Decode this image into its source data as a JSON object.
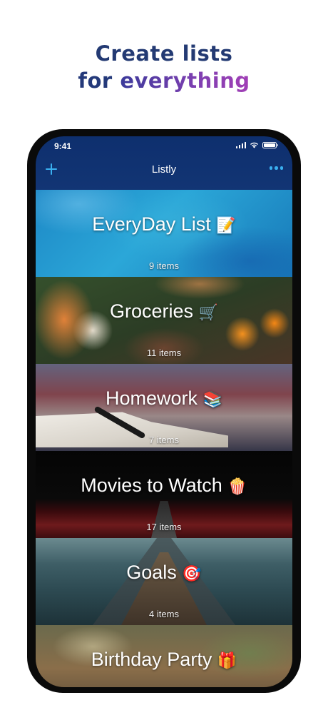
{
  "headline": {
    "line1": "Create lists",
    "line2_prefix": "for ",
    "line2_accent": "everything"
  },
  "status": {
    "time": "9:41"
  },
  "nav": {
    "title": "Listly",
    "add_icon": "plus-icon",
    "more_icon": "ellipsis-icon"
  },
  "lists": [
    {
      "name": "EveryDay List",
      "emoji": "📝",
      "count": "9 items"
    },
    {
      "name": "Groceries",
      "emoji": "🛒",
      "count": "11 items"
    },
    {
      "name": "Homework",
      "emoji": "📚",
      "count": "7 items"
    },
    {
      "name": "Movies to Watch",
      "emoji": "🍿",
      "count": "17 items"
    },
    {
      "name": "Goals",
      "emoji": "🎯",
      "count": "4 items"
    },
    {
      "name": "Birthday Party",
      "emoji": "🎁",
      "count": ""
    }
  ],
  "colors": {
    "accent": "#3ab0f0",
    "navbar": "#123574",
    "headline": "#233a73"
  }
}
